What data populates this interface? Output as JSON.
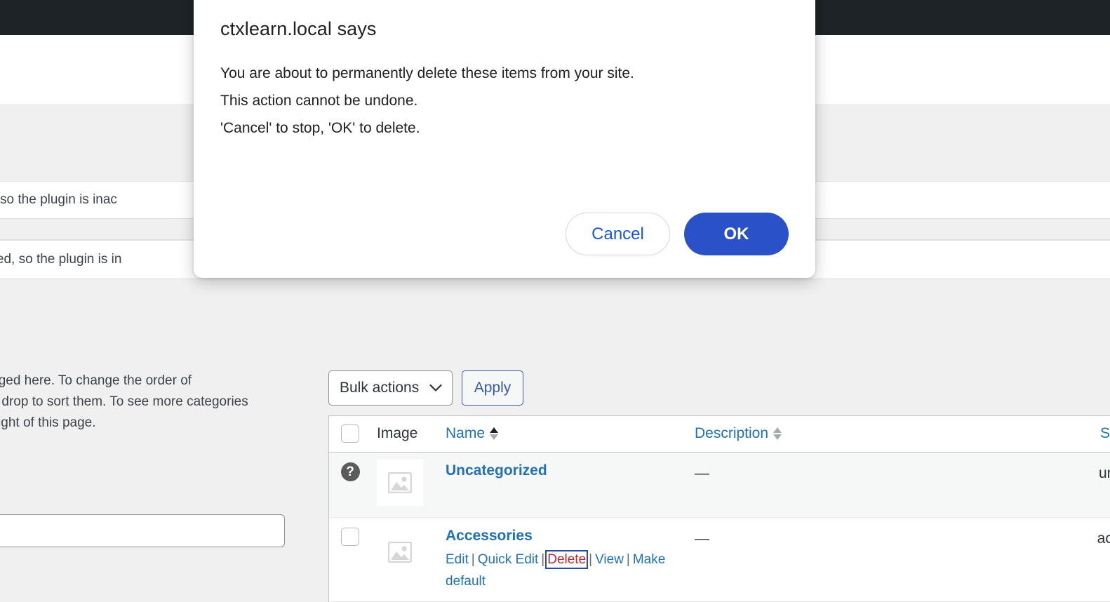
{
  "dialog": {
    "title": "ctxlearn.local says",
    "message": "You are about to permanently delete these items from your site.\nThis action cannot be undone.\n'Cancel' to stop, 'OK' to delete.",
    "cancel_label": "Cancel",
    "ok_label": "OK",
    "ok_color": "#2b51c8",
    "link_color": "#1a57d6"
  },
  "page": {
    "notices": [
      "ctivated, so the plugin is inac",
      "activated, so the plugin is in"
    ],
    "description_lines": [
      "anaged here. To change the order of",
      "nd drop to sort them. To see more categories",
      "top-right of this page."
    ],
    "search_input_value": "",
    "search_input_placeholder": ""
  },
  "toolbar": {
    "bulk_actions_label": "Bulk actions",
    "apply_label": "Apply",
    "caret_icon": "chevron-down-icon"
  },
  "table": {
    "columns": [
      {
        "key": "cb",
        "label": "",
        "sortable": false
      },
      {
        "key": "image",
        "label": "Image",
        "sortable": false
      },
      {
        "key": "name",
        "label": "Name",
        "sortable": true,
        "sorted": "asc"
      },
      {
        "key": "description",
        "label": "Description",
        "sortable": true,
        "sorted": "none"
      },
      {
        "key": "slug",
        "label": "Slug",
        "sortable": true,
        "sorted": "none"
      }
    ],
    "rows": [
      {
        "selector": "help-icon",
        "selector_glyph": "?",
        "image_icon": "image-placeholder-icon",
        "name": "Uncategorized",
        "description": "—",
        "slug": "uncate",
        "actions": []
      },
      {
        "selector": "checkbox",
        "image_icon": "image-placeholder-icon",
        "name": "Accessories",
        "description": "—",
        "slug": "access",
        "actions": [
          {
            "label": "Edit",
            "kind": "normal"
          },
          {
            "label": "Quick Edit",
            "kind": "normal"
          },
          {
            "label": "Delete",
            "kind": "danger",
            "focused": true
          },
          {
            "label": "View",
            "kind": "normal"
          },
          {
            "label": "Make default",
            "kind": "normal"
          }
        ]
      }
    ]
  },
  "colors": {
    "admin_bar": "#1d2327",
    "page_bg": "#f0f0f1",
    "link": "#2271b1",
    "danger": "#b32d2e",
    "row_stripe": "#f6f7f7"
  }
}
